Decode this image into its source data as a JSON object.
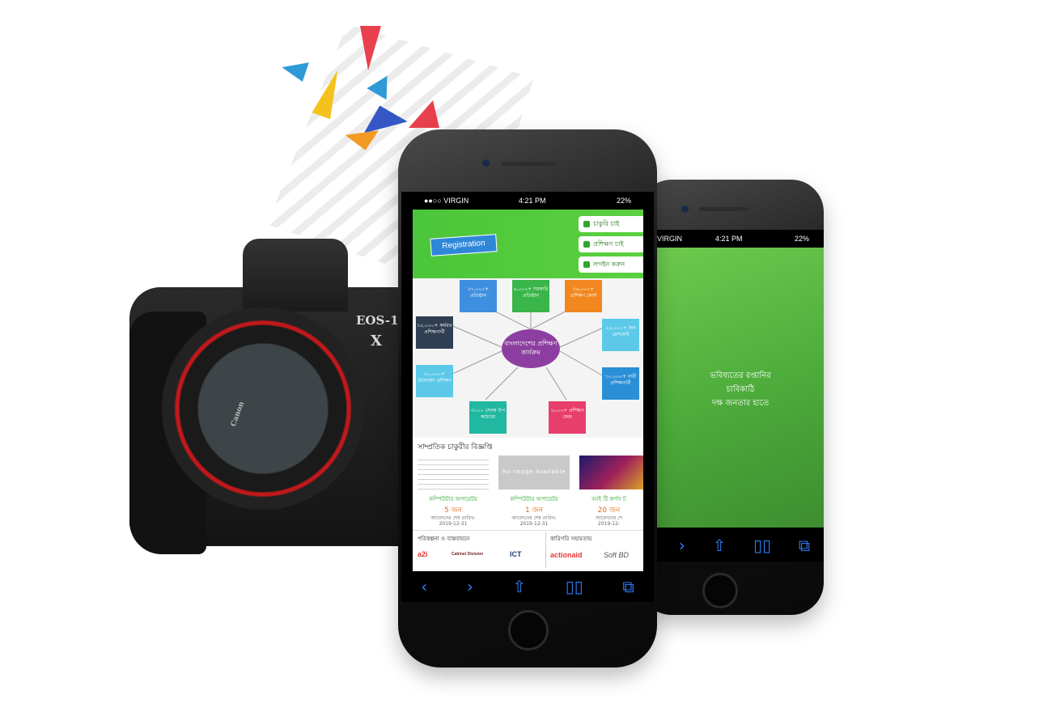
{
  "brand_colors": {
    "green": "#5cd040",
    "blue_link": "#2d7df6",
    "purple": "#8c3fa0"
  },
  "camera": {
    "model_label": "EOS-1D",
    "model_suffix": "X",
    "brand": "Canon"
  },
  "front_phone": {
    "status": {
      "carrier": "●●○○ VIRGIN",
      "time": "4:21 PM",
      "battery": "22%"
    },
    "hero": {
      "registration_label": "Registration",
      "menu": [
        "চাকুরি চাই",
        "প্রশিক্ষণ চাই",
        "লগইন করুন"
      ]
    },
    "mindmap": {
      "center": "বাংলাদেশের প্রশিক্ষণ কার্যক্রম",
      "nodes": [
        {
          "text": "২৭,০০০+ প্রতিষ্ঠান",
          "color": "#3f8fe0"
        },
        {
          "text": "৬,০০০+ সরকারি প্রতিষ্ঠান",
          "color": "#3ab54a"
        },
        {
          "text": "৩৬,০০০+ প্রশিক্ষণ কোর্স",
          "color": "#f2871f"
        },
        {
          "text": "১৫,০০০+ কর্মরত প্রশিক্ষণার্থী",
          "color": "#2f3e52"
        },
        {
          "text": "২৫,০০০+ জব প্লেসমেন্ট",
          "color": "#5cc9e8"
        },
        {
          "text": "২০,০০০+ উদ্যোক্তা প্রশিক্ষণ",
          "color": "#5cc9e8"
        },
        {
          "text": "১০,০০০+ নারী প্রশিক্ষণার্থী",
          "color": "#2b8fd6"
        },
        {
          "text": "৩০০০ সেবক উপ কাঠামো",
          "color": "#21b8a1"
        },
        {
          "text": "২০০০+ প্রশিক্ষণ কেন্দ্র",
          "color": "#e83e6b"
        }
      ]
    },
    "jobs": {
      "section_title": "সাম্প্রতিক চাকুরীর বিজ্ঞপ্তি",
      "cards": [
        {
          "title": "কম্পিউটার অপারেটর",
          "count": "5 জন",
          "deadline": "আবেদনের শেষ তারিখ:",
          "date": "2019-12-31",
          "image": "document"
        },
        {
          "title": "কম্পিউটার অপারেটর",
          "count": "1 জন",
          "deadline": "আবেদনের শেষ তারিখ:",
          "date": "2019-12-31",
          "image": "No Image Available"
        },
        {
          "title": "আই টি কর্পস ট",
          "count": "20 জন",
          "deadline": "আবেদনের শে",
          "date": "2019-12-",
          "image": "banner"
        }
      ]
    },
    "footer": {
      "left_title": "পরিকল্পনা ও বাস্তবায়নে",
      "right_title": "কারিগরি সহায়তায়",
      "logos_left": [
        "a2i",
        "Cabinet Division",
        "ICT"
      ],
      "logos_right": [
        "actionaid",
        "Soft BD"
      ]
    },
    "toolbar_icons": [
      "back-icon",
      "forward-icon",
      "share-icon",
      "bookmarks-icon",
      "tabs-icon"
    ]
  },
  "back_phone": {
    "status": {
      "carrier": "VIRGIN",
      "time": "4:21 PM",
      "battery": "22%"
    },
    "tagline": [
      "ভবিষ্যতের রপ্তানির",
      "চাবিকাঠি",
      "দক্ষ জনতার হাতে"
    ],
    "toolbar_icons": [
      "forward-icon",
      "share-icon",
      "bookmarks-icon",
      "tabs-icon"
    ]
  }
}
